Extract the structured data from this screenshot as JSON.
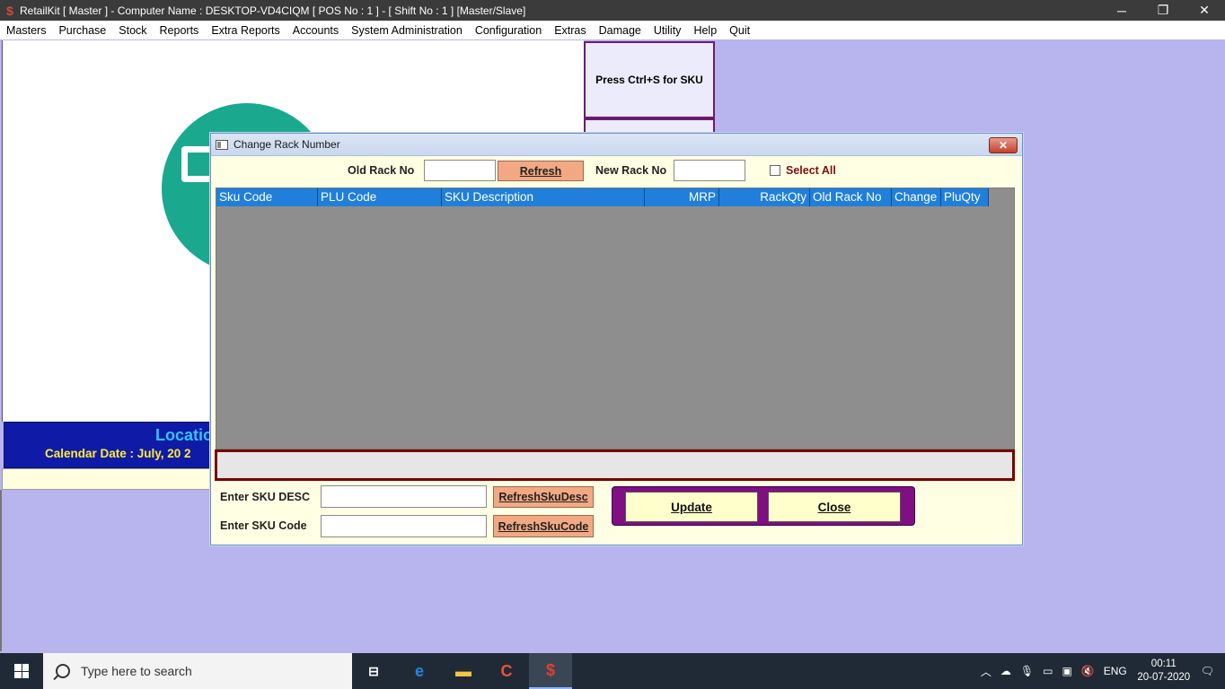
{
  "window": {
    "title": "RetailKit [ Master ] - Computer Name : DESKTOP-VD4CIQM [ POS No : 1 ] - [ Shift No : 1 ]  [Master/Slave]",
    "app_icon": "$",
    "minimize": "─",
    "restore": "❐",
    "close": "✕"
  },
  "menu": [
    "Masters",
    "Purchase",
    "Stock",
    "Reports",
    "Extra Reports",
    "Accounts",
    "System Administration",
    "Configuration",
    "Extras",
    "Damage",
    "Utility",
    "Help",
    "Quit"
  ],
  "background": {
    "sku_hint": "Press Ctrl+S for SKU",
    "location_label": "Locatio",
    "calendar_label": "Calendar Date : July, 20 2"
  },
  "dialog": {
    "title": "Change Rack Number",
    "close_label": "✕",
    "old_rack_label": "Old Rack No",
    "old_rack_value": "",
    "refresh_label": "Refresh",
    "new_rack_label": "New Rack No",
    "new_rack_value": "",
    "select_all_label": "Select All",
    "select_all_checked": false,
    "columns": [
      "Sku Code",
      "PLU Code",
      "SKU Description",
      "",
      "MRP",
      "RackQty",
      "Old Rack No",
      "Change",
      "PluQty"
    ],
    "rows": [],
    "status_text": "",
    "sku_desc_label": "Enter SKU DESC",
    "sku_desc_value": "",
    "refresh_sku_desc_label": "RefreshSkuDesc",
    "sku_code_label": "Enter SKU Code",
    "sku_code_value": "",
    "refresh_sku_code_label": "RefreshSkuCode",
    "update_label": "Update",
    "close_button_label": "Close"
  },
  "taskbar": {
    "search_placeholder": "Type here to search",
    "language": "ENG",
    "time": "00:11",
    "date": "20-07-2020"
  },
  "colors": {
    "grid_header": "#1f7fdb",
    "dialog_bg": "#ffffe4",
    "orange_button": "#f2a983",
    "update_panel": "#7f0f82",
    "desktop_bg": "#b7b4ee"
  }
}
